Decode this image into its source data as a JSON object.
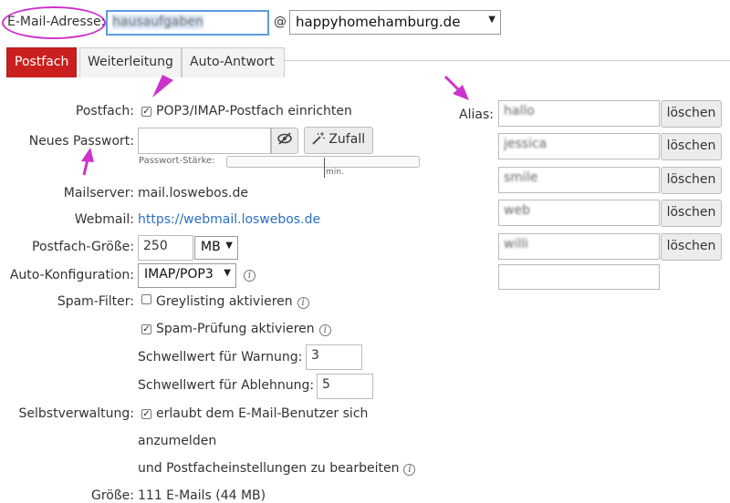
{
  "header": {
    "email_label": "E-Mail-Adresse:",
    "local_part": "hausaufgaben",
    "at_sign": "@",
    "domain": "happyhomehamburg.de"
  },
  "tabs": [
    {
      "label": "Postfach",
      "active": true
    },
    {
      "label": "Weiterleitung",
      "active": false
    },
    {
      "label": "Auto-Antwort",
      "active": false
    }
  ],
  "form": {
    "postfach_label": "Postfach:",
    "postfach_checkbox": "POP3/IMAP-Postfach einrichten",
    "password_label": "Neues Passwort:",
    "password_value": "",
    "zufall_button": "Zufall",
    "password_strength_label": "Passwort-Stärke:",
    "password_strength_min": "min.",
    "mailserver_label": "Mailserver:",
    "mailserver_value": "mail.loswebos.de",
    "webmail_label": "Webmail:",
    "webmail_value": "https://webmail.loswebos.de",
    "size_label": "Postfach-Größe:",
    "size_value": "250",
    "size_unit": "MB",
    "autoconf_label": "Auto-Konfiguration:",
    "autoconf_value": "IMAP/POP3",
    "spam_label": "Spam-Filter:",
    "greylisting": "Greylisting aktivieren",
    "greylisting_checked": false,
    "spam_check": "Spam-Prüfung aktivieren",
    "spam_check_checked": true,
    "warn_label": "Schwellwert für Warnung:",
    "warn_value": "3",
    "reject_label": "Schwellwert für Ablehnung:",
    "reject_value": "5",
    "self_label": "Selbstverwaltung:",
    "self_line1": "erlaubt dem E-Mail-Benutzer sich",
    "self_line2": "anzumelden",
    "self_line3": "und Postfacheinstellungen zu bearbeiten",
    "groesse_label": "Größe:",
    "groesse_value": "111 E-Mails (44 MB)"
  },
  "alias": {
    "label": "Alias:",
    "delete_label": "löschen",
    "entries": [
      "hallo",
      "jessica",
      "smile",
      "web",
      "willi",
      ""
    ]
  },
  "colors": {
    "accent_red": "#c9201f",
    "annotation_magenta": "#cc33cc",
    "link_blue": "#2a6fc0"
  },
  "icons": [
    "eye-slash-icon",
    "magic-wand-icon",
    "info-icon",
    "checkbox-icon",
    "dropdown-arrow-icon"
  ]
}
